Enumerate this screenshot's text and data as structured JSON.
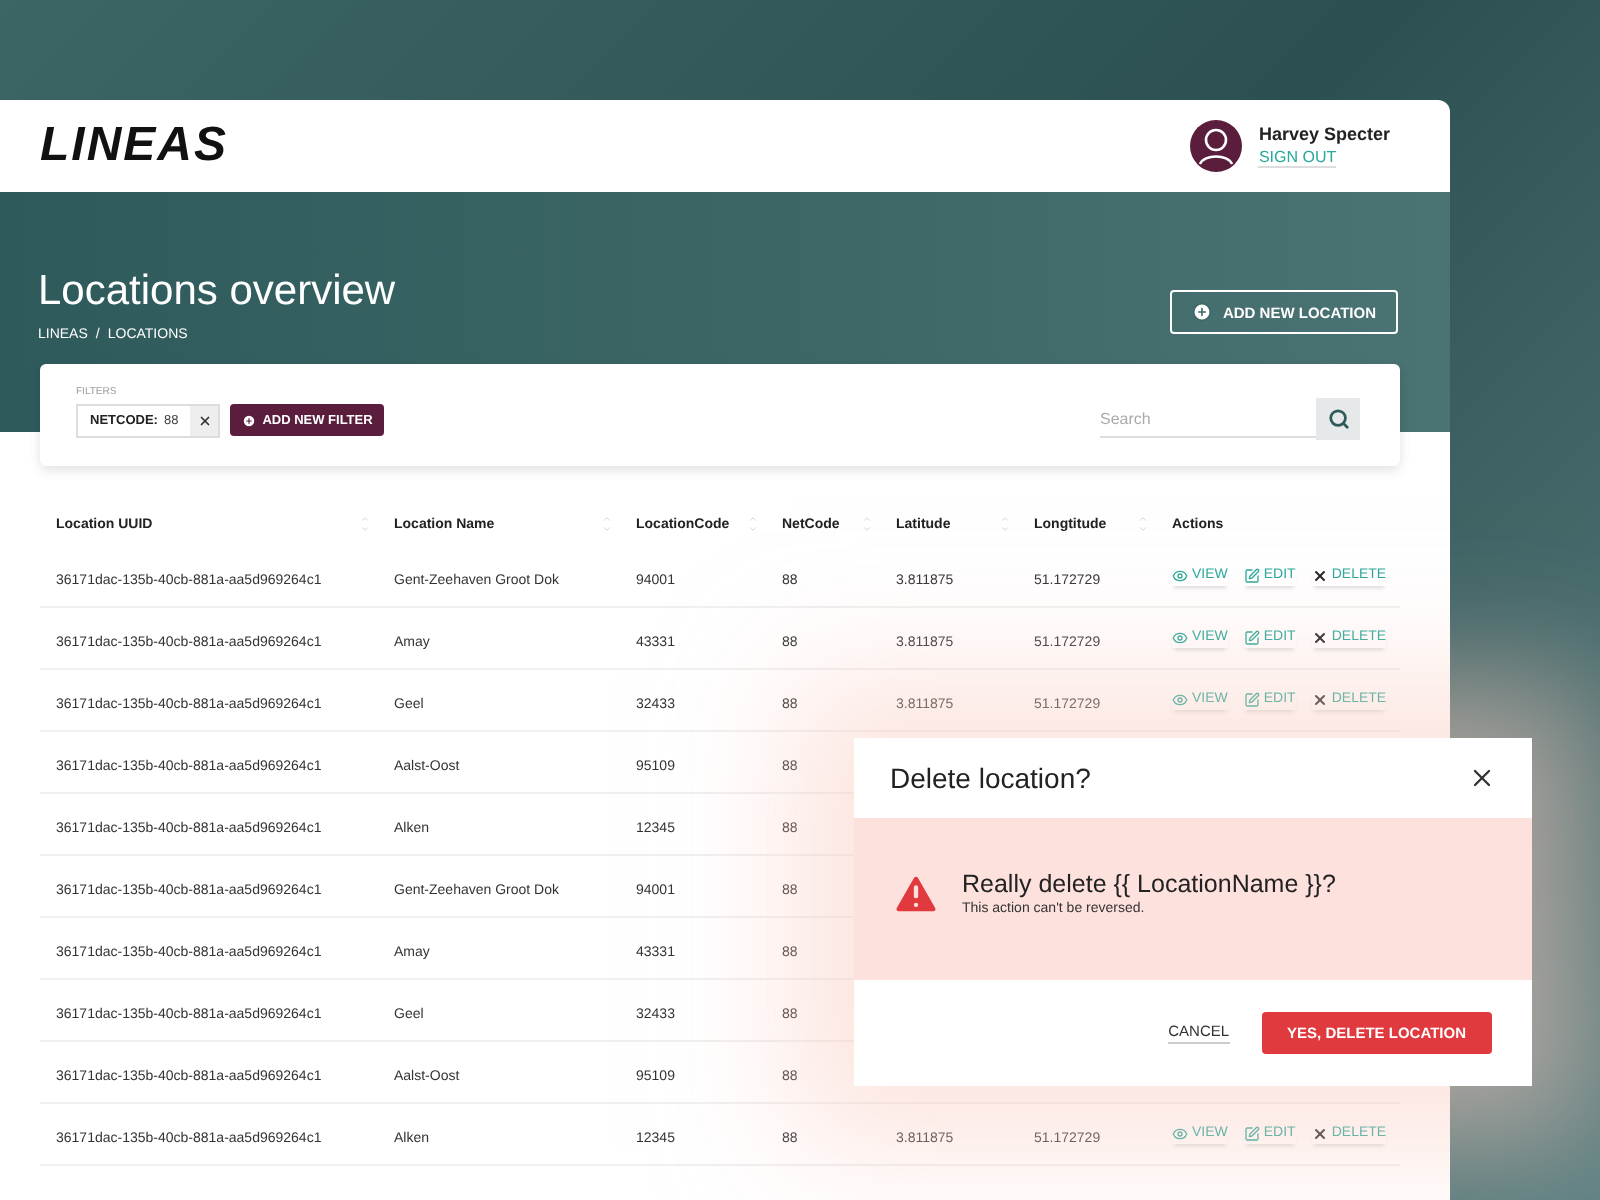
{
  "header": {
    "logo": "LINEAS",
    "user": {
      "name": "Harvey Specter",
      "sign_out": "SIGN OUT"
    }
  },
  "hero": {
    "title": "Locations overview",
    "breadcrumb": [
      "LINEAS",
      "LOCATIONS"
    ],
    "separator": "/",
    "add_button": "ADD NEW LOCATION"
  },
  "filters": {
    "label": "FILTERS",
    "chips": [
      {
        "key": "NETCODE:",
        "value": "88"
      }
    ],
    "add_button": "ADD NEW FILTER",
    "search": {
      "placeholder": "Search"
    }
  },
  "table": {
    "columns": [
      {
        "label": "Location UUID",
        "sortable": true
      },
      {
        "label": "Location Name",
        "sortable": true
      },
      {
        "label": "LocationCode",
        "sortable": true
      },
      {
        "label": "NetCode",
        "sortable": true
      },
      {
        "label": "Latitude",
        "sortable": true
      },
      {
        "label": "Longtitude",
        "sortable": true
      },
      {
        "label": "Actions",
        "sortable": false
      }
    ],
    "rows": [
      {
        "cells": [
          "36171dac-135b-40cb-881a-aa5d969264c1",
          "Gent-Zeehaven Groot Dok",
          "94001",
          "88",
          "3.811875",
          "51.172729"
        ],
        "actions": [
          {
            "kind": "view",
            "label": "VIEW"
          },
          {
            "kind": "edit",
            "label": "EDIT"
          },
          {
            "kind": "delete",
            "label": "DELETE"
          }
        ]
      },
      {
        "cells": [
          "36171dac-135b-40cb-881a-aa5d969264c1",
          "Amay",
          "43331",
          "88",
          "3.811875",
          "51.172729"
        ],
        "actions": [
          {
            "kind": "view",
            "label": "VIEW"
          },
          {
            "kind": "edit",
            "label": "EDIT"
          },
          {
            "kind": "delete",
            "label": "DELETE"
          }
        ]
      },
      {
        "cells": [
          "36171dac-135b-40cb-881a-aa5d969264c1",
          "Geel",
          "32433",
          "88",
          "3.811875",
          "51.172729"
        ],
        "actions": [
          {
            "kind": "view",
            "label": "VIEW"
          },
          {
            "kind": "edit",
            "label": "EDIT"
          },
          {
            "kind": "delete",
            "label": "DELETE"
          }
        ]
      },
      {
        "cells": [
          "36171dac-135b-40cb-881a-aa5d969264c1",
          "Aalst-Oost",
          "95109",
          "88"
        ]
      },
      {
        "cells": [
          "36171dac-135b-40cb-881a-aa5d969264c1",
          "Alken",
          "12345",
          "88"
        ]
      },
      {
        "cells": [
          "36171dac-135b-40cb-881a-aa5d969264c1",
          "Gent-Zeehaven Groot Dok",
          "94001",
          "88"
        ]
      },
      {
        "cells": [
          "36171dac-135b-40cb-881a-aa5d969264c1",
          "Amay",
          "43331",
          "88"
        ]
      },
      {
        "cells": [
          "36171dac-135b-40cb-881a-aa5d969264c1",
          "Geel",
          "32433",
          "88"
        ]
      },
      {
        "cells": [
          "36171dac-135b-40cb-881a-aa5d969264c1",
          "Aalst-Oost",
          "95109",
          "88"
        ]
      },
      {
        "cells": [
          "36171dac-135b-40cb-881a-aa5d969264c1",
          "Alken",
          "12345",
          "88",
          "3.811875",
          "51.172729"
        ],
        "actions": [
          {
            "kind": "view",
            "label": "VIEW"
          },
          {
            "kind": "edit",
            "label": "EDIT"
          },
          {
            "kind": "delete",
            "label": "DELETE"
          }
        ]
      }
    ]
  },
  "dialog": {
    "title": "Delete location?",
    "message": "Really delete {{ LocationName }}?",
    "note": "This action can't be reversed.",
    "cancel": "CANCEL",
    "confirm": "YES, DELETE LOCATION"
  }
}
